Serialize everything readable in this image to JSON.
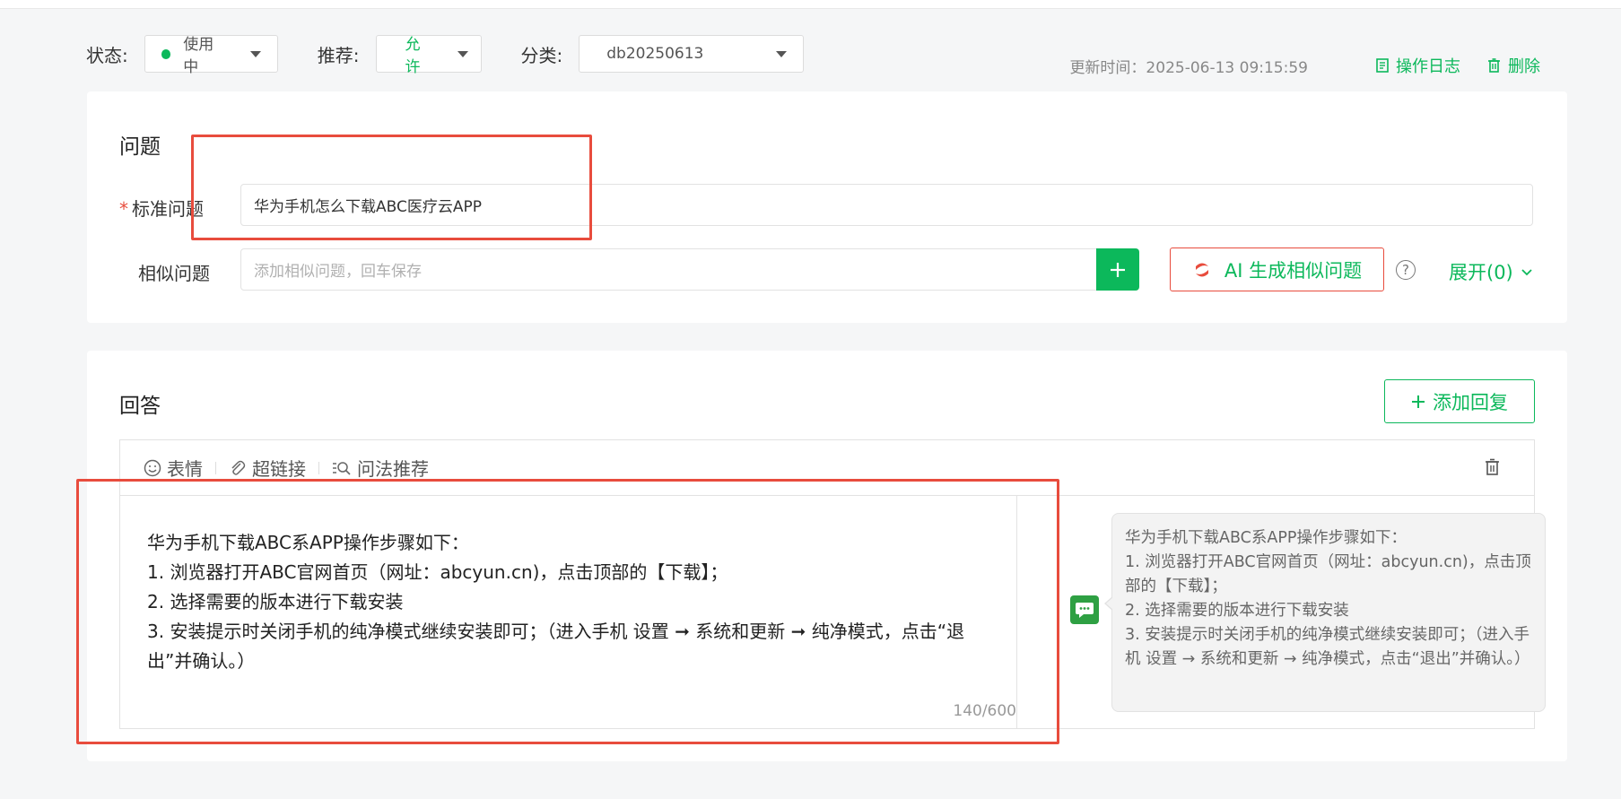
{
  "filters": {
    "status_label": "状态:",
    "status_value": "使用中",
    "recommend_label": "推荐:",
    "recommend_value": "允许",
    "category_label": "分类:",
    "category_value": "db20250613"
  },
  "meta": {
    "updated": "更新时间：2025-06-13 09:15:59",
    "log_label": "操作日志",
    "delete_label": "删除"
  },
  "question": {
    "title": "问题",
    "std_label": "标准问题",
    "std_required": "*",
    "std_value": "华为手机怎么下载ABC医疗云APP",
    "similar_label": "相似问题",
    "similar_placeholder": "添加相似问题，回车保存",
    "ai_label": "AI 生成相似问题",
    "help_symbol": "?",
    "expand_label": "展开(0)"
  },
  "answer": {
    "title": "回答",
    "add_reply_label": "添加回复",
    "toolbar": {
      "emoji_label": "表情",
      "link_label": "超链接",
      "recommend_label": "问法推荐"
    },
    "content_lines": [
      "华为手机下载ABC系APP操作步骤如下：",
      "1. 浏览器打开ABC官网首页（网址：abcyun.cn)，点击顶部的【下载】；",
      "2. 选择需要的版本进行下载安装",
      "3. 安装提示时关闭手机的纯净模式继续安装即可；（进入手机 设置 ➞ 系统和更新 ➞ 纯净模式，点击“退出”并确认。）"
    ],
    "counter": "140/600",
    "preview_lines": [
      "华为手机下载ABC系APP操作步骤如下：",
      "1. 浏览器打开ABC官网首页（网址：abcyun.cn)，点击顶部的【下载】；",
      "2. 选择需要的版本进行下载安装",
      "3. 安装提示时关闭手机的纯净模式继续安装即可；（进入手机 设置 → 系统和更新 → 纯净模式，点击“退出”并确认。）"
    ]
  },
  "colors": {
    "accent": "#0cb85b",
    "highlight": "#e84c3d"
  }
}
